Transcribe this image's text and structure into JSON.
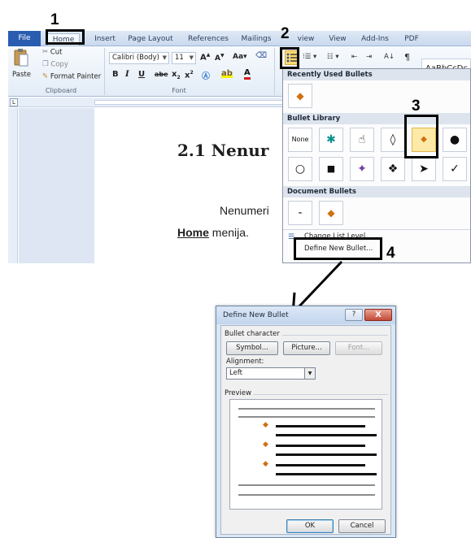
{
  "steps": {
    "one": "1",
    "two": "2",
    "three": "3",
    "four": "4"
  },
  "ribbon": {
    "tabs": [
      "File",
      "Home",
      "Insert",
      "Page Layout",
      "References",
      "Mailings",
      "view",
      "View",
      "Add-Ins",
      "PDF"
    ],
    "clipboard": {
      "paste": "Paste",
      "cut": "Cut",
      "copy": "Copy",
      "format_painter": "Format Painter",
      "group": "Clipboard"
    },
    "font": {
      "name": "Calibri (Body)",
      "size": "11",
      "grow": "A",
      "shrink": "A",
      "case": "Aa",
      "group": "Font",
      "bold": "B",
      "italic": "I",
      "underline": "U",
      "strike": "abe",
      "sub": "x",
      "super": "x"
    },
    "styles_preview": "AaBbCcDc"
  },
  "document": {
    "heading": "2.1  Nenur",
    "line1": "Nenumeri",
    "line2_bold": "Home",
    "line2_rest": " menija."
  },
  "bullet_menu": {
    "recent_title": "Recently Used Bullets",
    "library_title": "Bullet Library",
    "document_title": "Document Bullets",
    "none_label": "None",
    "library_row1": [
      "None",
      "✱",
      "☝",
      "◊",
      "◆",
      "●"
    ],
    "library_row2": [
      "○",
      "■",
      "✦",
      "❖",
      "➤",
      "✓"
    ],
    "document_bullets": [
      "-",
      "◆"
    ],
    "change_level": "Change List Level",
    "define_new": "Define New Bullet..."
  },
  "dialog": {
    "title": "Define New Bullet",
    "help": "?",
    "close": "X",
    "section_bullet": "Bullet character",
    "symbol_btn": "Symbol...",
    "picture_btn": "Picture...",
    "font_btn": "Font...",
    "alignment_label": "Alignment:",
    "alignment_value": "Left",
    "preview_label": "Preview",
    "ok": "OK",
    "cancel": "Cancel"
  },
  "colors": {
    "accent": "#2a5db0",
    "bullet": "#d07010",
    "highlight": "#000000"
  }
}
